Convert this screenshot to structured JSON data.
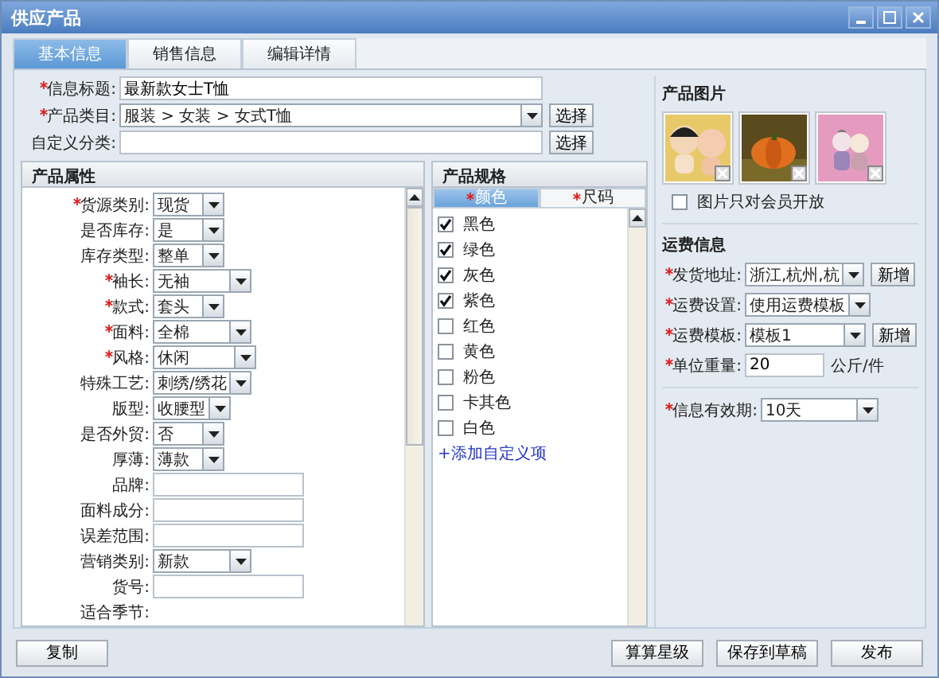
{
  "window": {
    "title": "供应产品"
  },
  "tabs": [
    {
      "label": "基本信息",
      "selected": true
    },
    {
      "label": "销售信息",
      "selected": false
    },
    {
      "label": "编辑详情",
      "selected": false
    }
  ],
  "basic": [
    {
      "label": "信息标题:",
      "required": true,
      "kind": "input",
      "value": "最新款女士T恤"
    },
    {
      "label": "产品类目:",
      "required": true,
      "kind": "select",
      "value": "服装 > 女装 > 女式T恤",
      "button": "选择"
    },
    {
      "label": "自定义分类:",
      "required": false,
      "kind": "input",
      "button": "选择"
    }
  ],
  "attributes": {
    "title": "产品属性",
    "rows": [
      {
        "label": "货源类别:",
        "required": true,
        "kind": "select",
        "value": "现货"
      },
      {
        "label": "是否库存:",
        "required": false,
        "kind": "select",
        "value": "是"
      },
      {
        "label": "库存类型:",
        "required": false,
        "kind": "select",
        "value": "整单"
      },
      {
        "label": "袖长:",
        "required": true,
        "kind": "select",
        "value": "无袖"
      },
      {
        "label": "款式:",
        "required": true,
        "kind": "select",
        "value": "套头"
      },
      {
        "label": "面料:",
        "required": true,
        "kind": "select",
        "value": "全棉"
      },
      {
        "label": "风格:",
        "required": true,
        "kind": "select",
        "value": "休闲"
      },
      {
        "label": "特殊工艺:",
        "required": false,
        "kind": "select",
        "value": "刺绣/绣花"
      },
      {
        "label": "版型:",
        "required": false,
        "kind": "select",
        "value": "收腰型"
      },
      {
        "label": "是否外贸:",
        "required": false,
        "kind": "select",
        "value": "否"
      },
      {
        "label": "厚薄:",
        "required": false,
        "kind": "select",
        "value": "薄款"
      },
      {
        "label": "品牌:",
        "required": false,
        "kind": "input"
      },
      {
        "label": "面料成分:",
        "required": false,
        "kind": "input"
      },
      {
        "label": "误差范围:",
        "required": false,
        "kind": "input"
      },
      {
        "label": "营销类别:",
        "required": false,
        "kind": "select",
        "value": "新款"
      },
      {
        "label": "货号:",
        "required": false,
        "kind": "input"
      },
      {
        "label": "适合季节:",
        "required": false,
        "kind": "label"
      }
    ]
  },
  "spec": {
    "title": "产品规格",
    "tabs": [
      {
        "label": "颜色",
        "required": true,
        "selected": true
      },
      {
        "label": "尺码",
        "required": true,
        "selected": false
      }
    ],
    "options": [
      {
        "label": "黑色",
        "checked": true
      },
      {
        "label": "绿色",
        "checked": true
      },
      {
        "label": "灰色",
        "checked": true
      },
      {
        "label": "紫色",
        "checked": true
      },
      {
        "label": "红色",
        "checked": false
      },
      {
        "label": "黄色",
        "checked": false
      },
      {
        "label": "粉色",
        "checked": false
      },
      {
        "label": "卡其色",
        "checked": false
      },
      {
        "label": "白色",
        "checked": false
      }
    ],
    "add_link": "+添加自定义项"
  },
  "images": {
    "title": "产品图片",
    "members_only": {
      "label": "图片只对会员开放",
      "checked": false
    }
  },
  "shipping": {
    "title": "运费信息",
    "rows": [
      {
        "label": "发货地址:",
        "required": true,
        "kind": "select",
        "value": "浙江,杭州,杭",
        "button": "新增"
      },
      {
        "label": "运费设置:",
        "required": true,
        "kind": "select",
        "value": "使用运费模板"
      },
      {
        "label": "运费模板:",
        "required": true,
        "kind": "select",
        "value": "模板1",
        "button": "新增"
      },
      {
        "label": "单位重量:",
        "required": true,
        "kind": "input",
        "value": "20",
        "unit": "公斤/件"
      }
    ]
  },
  "validity": {
    "label": "信息有效期:",
    "required": true,
    "value": "10天"
  },
  "footer": {
    "left": [
      "复制"
    ],
    "right": [
      "算算星级",
      "保存到草稿",
      "发布"
    ]
  }
}
